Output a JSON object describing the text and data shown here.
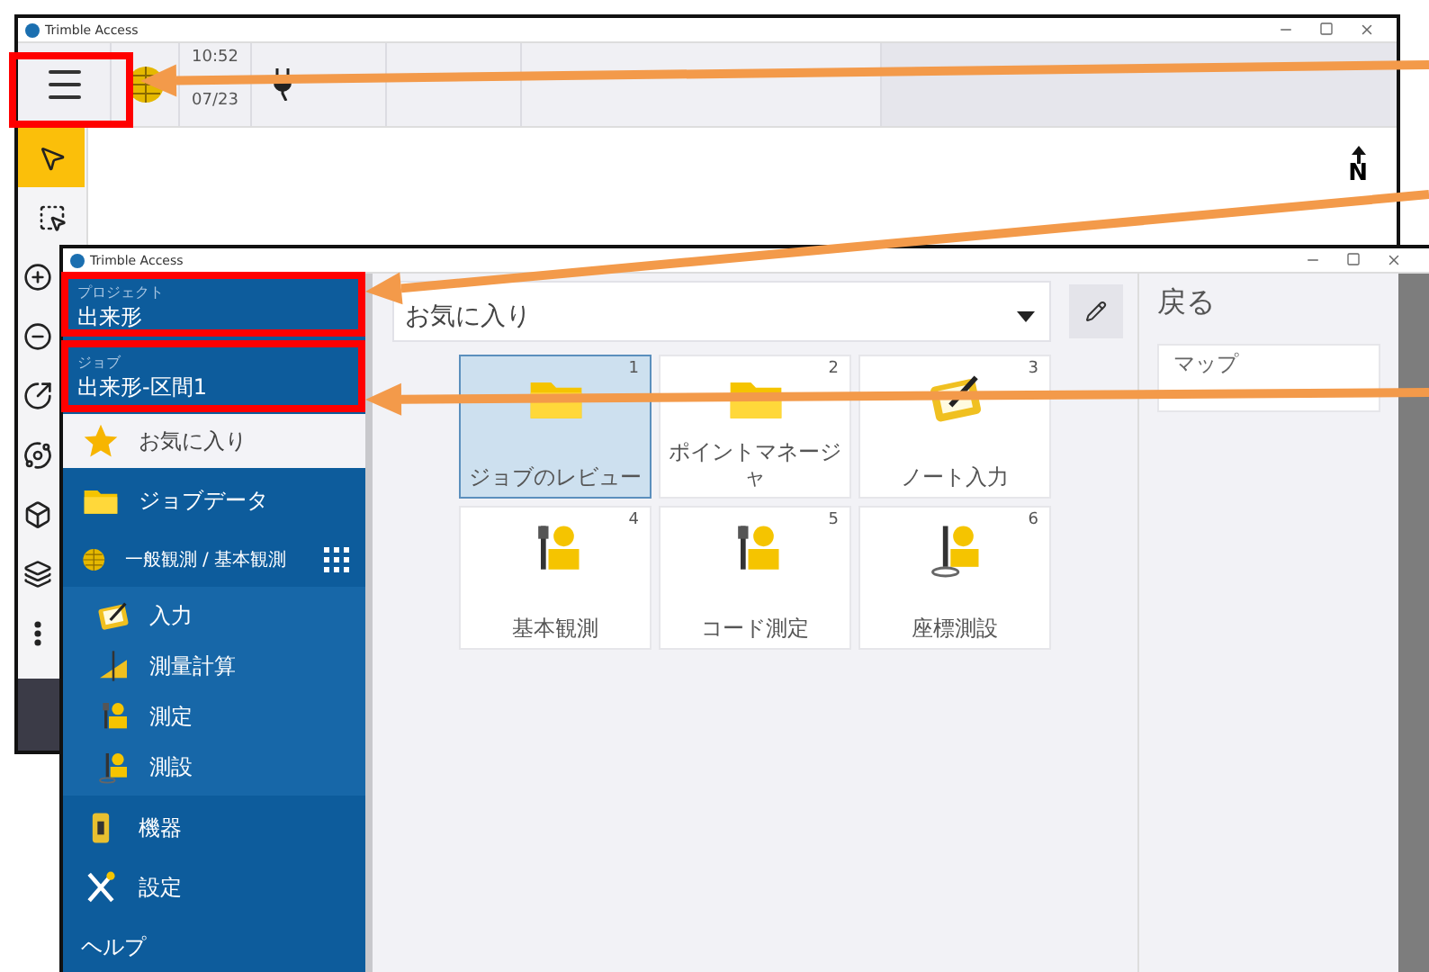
{
  "back_window": {
    "title": "Trimble Access",
    "status": {
      "time": "10:52",
      "date": "07/23"
    },
    "map_tools": [
      {
        "kind": "select",
        "selected": true
      },
      {
        "kind": "box_select",
        "selected": false
      },
      {
        "kind": "zoom_in",
        "selected": false
      },
      {
        "kind": "zoom_out",
        "selected": false
      },
      {
        "kind": "zoom_extents",
        "selected": false
      },
      {
        "kind": "orbit",
        "selected": false
      },
      {
        "kind": "cube",
        "selected": false
      },
      {
        "kind": "layers",
        "selected": false
      },
      {
        "kind": "more",
        "selected": false
      }
    ],
    "north_label": "N"
  },
  "front_window": {
    "title": "Trimble Access",
    "sidebar": {
      "project": {
        "label": "プロジェクト",
        "value": "出来形"
      },
      "job": {
        "label": "ジョブ",
        "value": "出来形-区間1"
      },
      "items": [
        {
          "label": "お気に入り",
          "selected": true
        },
        {
          "label": "ジョブデータ",
          "selected": false
        },
        {
          "label": "一般観測 / 基本観測",
          "selected": false,
          "expanded": true,
          "children": [
            {
              "label": "入力",
              "selected": false
            },
            {
              "label": "測量計算",
              "selected": false
            },
            {
              "label": "測定",
              "selected": false
            },
            {
              "label": "測設",
              "selected": false
            }
          ]
        },
        {
          "label": "機器",
          "selected": false
        },
        {
          "label": "設定",
          "selected": false
        },
        {
          "label": "ヘルプ",
          "selected": false
        }
      ]
    },
    "favorites": {
      "dropdown": "お気に入り",
      "tiles": [
        {
          "number": "1",
          "label": "ジョブのレビュー",
          "selected": true
        },
        {
          "number": "2",
          "label": "ポイントマネージャ",
          "selected": false
        },
        {
          "number": "3",
          "label": "ノート入力",
          "selected": false
        },
        {
          "number": "4",
          "label": "基本観測",
          "selected": false
        },
        {
          "number": "5",
          "label": "コード測定",
          "selected": false
        },
        {
          "number": "6",
          "label": "座標測設",
          "selected": false
        }
      ]
    },
    "side_panel": {
      "title": "戻る",
      "items": [
        "マップ"
      ]
    }
  }
}
